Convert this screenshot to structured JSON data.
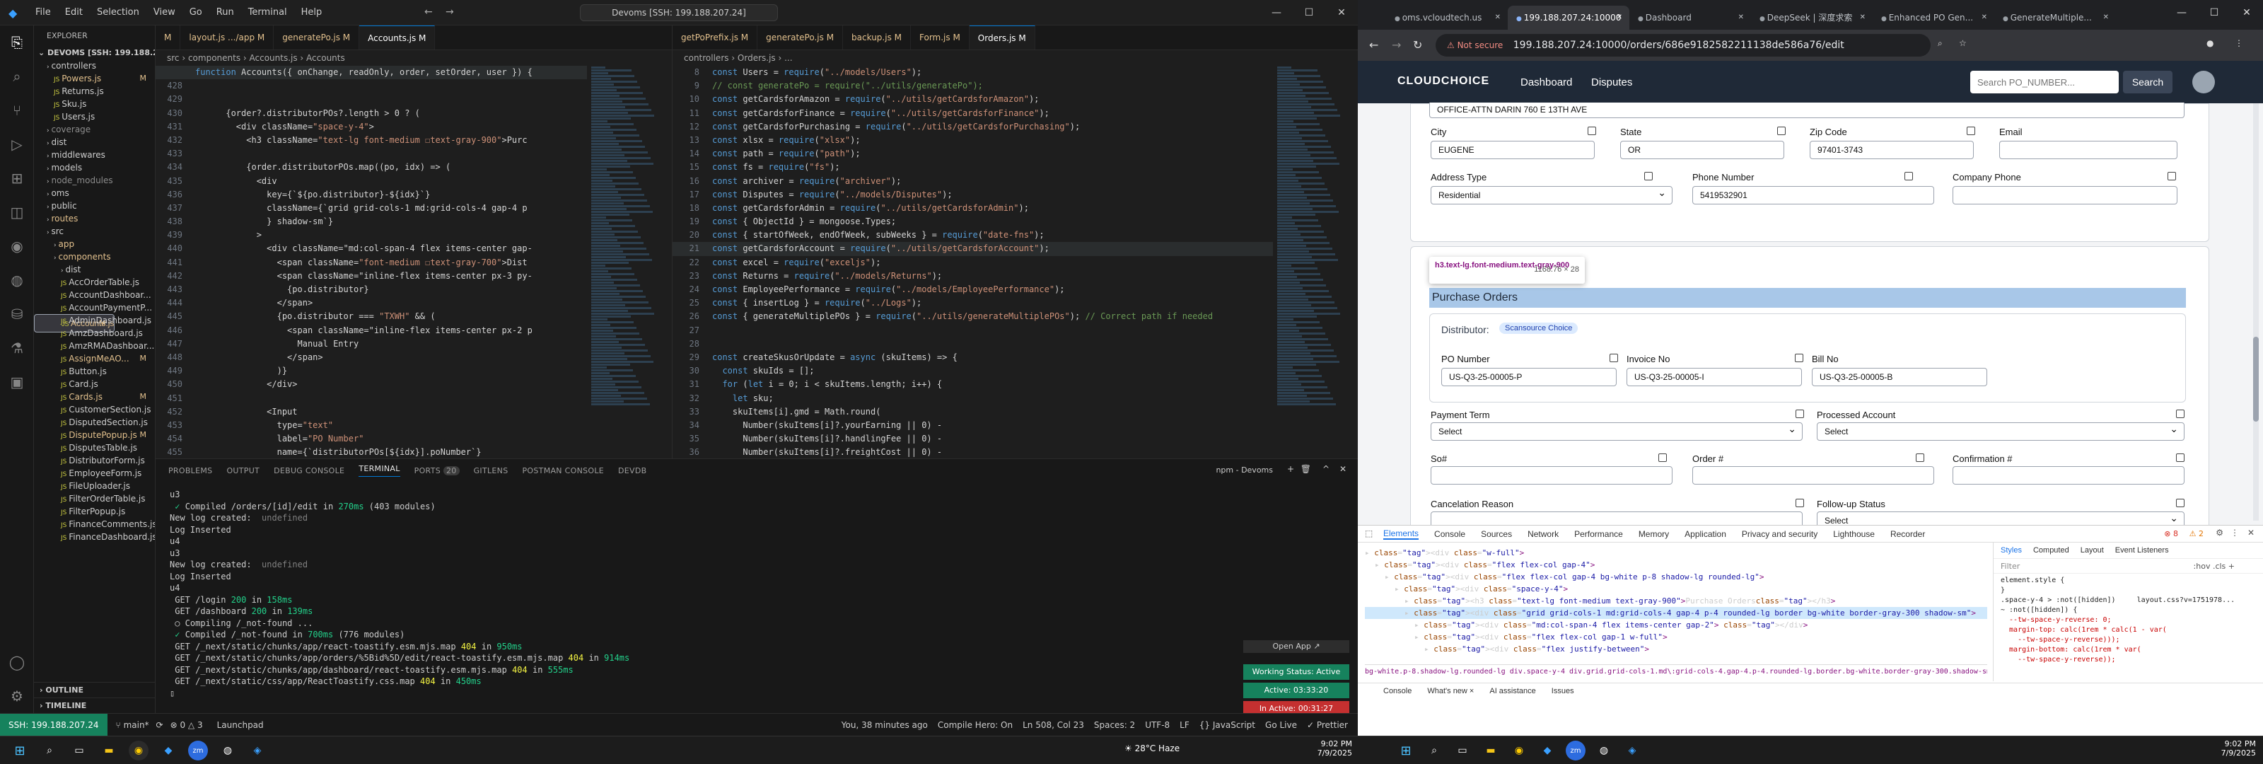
{
  "vscode": {
    "menu": [
      "File",
      "Edit",
      "Selection",
      "View",
      "Go",
      "Run",
      "Terminal",
      "Help"
    ],
    "search": "Devoms [SSH: 199.188.207.24]",
    "explorer_title": "EXPLORER",
    "root": "DEVOMS [SSH: 199.188.20...",
    "tree": [
      {
        "label": "controllers",
        "indent": 1,
        "badge": "",
        "color": "#cccccc"
      },
      {
        "label": "Powers.js",
        "indent": 2,
        "badge": "M",
        "color": "#e2c08d"
      },
      {
        "label": "Returns.js",
        "indent": 2,
        "badge": "",
        "color": "#cccccc"
      },
      {
        "label": "Sku.js",
        "indent": 2,
        "badge": "",
        "color": "#cccccc"
      },
      {
        "label": "Users.js",
        "indent": 2,
        "badge": "",
        "color": "#cccccc"
      },
      {
        "label": "coverage",
        "indent": 1,
        "badge": "",
        "color": "#8b8b8b"
      },
      {
        "label": "dist",
        "indent": 1,
        "badge": "",
        "color": "#cccccc"
      },
      {
        "label": "middlewares",
        "indent": 1,
        "badge": "",
        "color": "#cccccc"
      },
      {
        "label": "models",
        "indent": 1,
        "badge": "",
        "color": "#cccccc"
      },
      {
        "label": "node_modules",
        "indent": 1,
        "badge": "",
        "color": "#8b8b8b"
      },
      {
        "label": "oms",
        "indent": 1,
        "badge": "",
        "color": "#cccccc"
      },
      {
        "label": "public",
        "indent": 1,
        "badge": "",
        "color": "#cccccc"
      },
      {
        "label": "routes",
        "indent": 1,
        "badge": "",
        "color": "#e2c08d"
      },
      {
        "label": "src",
        "indent": 1,
        "badge": "",
        "color": "#cccccc"
      },
      {
        "label": "app",
        "indent": 2,
        "badge": "",
        "color": "#e2c08d"
      },
      {
        "label": "components",
        "indent": 2,
        "badge": "",
        "color": "#e2c08d"
      },
      {
        "label": "dist",
        "indent": 3,
        "badge": "",
        "color": "#cccccc"
      },
      {
        "label": "AccOrderTable.js",
        "indent": 3,
        "badge": "",
        "color": "#cccccc"
      },
      {
        "label": "AccountDashboar...",
        "indent": 3,
        "badge": "",
        "color": "#cccccc"
      },
      {
        "label": "AccountPaymentP...",
        "indent": 3,
        "badge": "",
        "color": "#cccccc"
      },
      {
        "label": "Accounts.js",
        "indent": 3,
        "badge": "M",
        "color": "#e2c08d",
        "sel": true
      },
      {
        "label": "AdminDashboard.js",
        "indent": 3,
        "badge": "",
        "color": "#cccccc"
      },
      {
        "label": "AmzDashboard.js",
        "indent": 3,
        "badge": "",
        "color": "#cccccc"
      },
      {
        "label": "AmzRMADashboar...",
        "indent": 3,
        "badge": "",
        "color": "#cccccc"
      },
      {
        "label": "AssignMeAO...",
        "indent": 3,
        "badge": "M",
        "color": "#e2c08d"
      },
      {
        "label": "Button.js",
        "indent": 3,
        "badge": "",
        "color": "#cccccc"
      },
      {
        "label": "Card.js",
        "indent": 3,
        "badge": "",
        "color": "#cccccc"
      },
      {
        "label": "Cards.js",
        "indent": 3,
        "badge": "M",
        "color": "#e2c08d"
      },
      {
        "label": "CustomerSection.js",
        "indent": 3,
        "badge": "",
        "color": "#cccccc"
      },
      {
        "label": "DisputedSection.js",
        "indent": 3,
        "badge": "",
        "color": "#cccccc"
      },
      {
        "label": "DisputePopup.js",
        "indent": 3,
        "badge": "M",
        "color": "#e2c08d"
      },
      {
        "label": "DisputesTable.js",
        "indent": 3,
        "badge": "",
        "color": "#cccccc"
      },
      {
        "label": "DistributorForm.js",
        "indent": 3,
        "badge": "",
        "color": "#cccccc"
      },
      {
        "label": "EmployeeForm.js",
        "indent": 3,
        "badge": "",
        "color": "#cccccc"
      },
      {
        "label": "FileUploader.js",
        "indent": 3,
        "badge": "",
        "color": "#cccccc"
      },
      {
        "label": "FilterOrderTable.js",
        "indent": 3,
        "badge": "",
        "color": "#cccccc"
      },
      {
        "label": "FilterPopup.js",
        "indent": 3,
        "badge": "",
        "color": "#cccccc"
      },
      {
        "label": "FinanceComments.js",
        "indent": 3,
        "badge": "",
        "color": "#cccccc"
      },
      {
        "label": "FinanceDashboard.js",
        "indent": 3,
        "badge": "",
        "color": "#cccccc"
      }
    ],
    "outline": "OUTLINE",
    "timeline": "TIMELINE",
    "tabs1": [
      {
        "label": "M",
        "active": false
      },
      {
        "label": "layout.js .../app M",
        "active": false
      },
      {
        "label": "generatePo.js M",
        "active": false
      },
      {
        "label": "Accounts.js M",
        "active": true
      }
    ],
    "bread1": "src › components › Accounts.js › Accounts",
    "code1": [
      {
        "n": "",
        "t": "function Accounts({ onChange, readOnly, order, setOrder, user }) {"
      },
      {
        "n": "428",
        "t": ""
      },
      {
        "n": "429",
        "t": ""
      },
      {
        "n": "430",
        "t": "      {order?.distributorPOs?.length > 0 ? ("
      },
      {
        "n": "431",
        "t": "        <div className=\"space-y-4\">"
      },
      {
        "n": "432",
        "t": "          <h3 className=\"text-lg font-medium ☐text-gray-900\">Purc"
      },
      {
        "n": "433",
        "t": ""
      },
      {
        "n": "434",
        "t": "          {order.distributorPOs.map((po, idx) => ("
      },
      {
        "n": "435",
        "t": "            <div"
      },
      {
        "n": "436",
        "t": "              key={`${po.distributor}-${idx}`}"
      },
      {
        "n": "437",
        "t": "              className={`grid grid-cols-1 md:grid-cols-4 gap-4 p"
      },
      {
        "n": "438",
        "t": "              } shadow-sm`}"
      },
      {
        "n": "439",
        "t": "            >"
      },
      {
        "n": "440",
        "t": "              <div className=\"md:col-span-4 flex items-center gap-"
      },
      {
        "n": "441",
        "t": "                <span className=\"font-medium ☐text-gray-700\">Dist"
      },
      {
        "n": "442",
        "t": "                <span className=\"inline-flex items-center px-3 py-"
      },
      {
        "n": "443",
        "t": "                  {po.distributor}"
      },
      {
        "n": "444",
        "t": "                </span>"
      },
      {
        "n": "445",
        "t": "                {po.distributor === \"TXWH\" && ("
      },
      {
        "n": "446",
        "t": "                  <span className=\"inline-flex items-center px-2 p"
      },
      {
        "n": "447",
        "t": "                    Manual Entry"
      },
      {
        "n": "448",
        "t": "                  </span>"
      },
      {
        "n": "449",
        "t": "                )}"
      },
      {
        "n": "450",
        "t": "              </div>"
      },
      {
        "n": "451",
        "t": ""
      },
      {
        "n": "452",
        "t": "              <Input"
      },
      {
        "n": "453",
        "t": "                type=\"text\""
      },
      {
        "n": "454",
        "t": "                label=\"PO Number\""
      },
      {
        "n": "455",
        "t": "                name={`distributorPOs[${idx}].poNumber`}"
      }
    ],
    "tabs2": [
      {
        "label": "getPoPrefix.js M",
        "active": false
      },
      {
        "label": "generatePo.js M",
        "active": false
      },
      {
        "label": "backup.js M",
        "active": false
      },
      {
        "label": "Form.js M",
        "active": false
      },
      {
        "label": "Orders.js M",
        "active": true
      }
    ],
    "bread2": "controllers › Orders.js › ...",
    "code2": [
      {
        "n": "8",
        "t": "const Users = require(\"../models/Users\");"
      },
      {
        "n": "9",
        "t": "// const generatePo = require(\"../utils/generatePo\");"
      },
      {
        "n": "10",
        "t": "const getCardsforAmazon = require(\"../utils/getCardsforAmazon\");"
      },
      {
        "n": "11",
        "t": "const getCardsforFinance = require(\"../utils/getCardsforFinance\");"
      },
      {
        "n": "12",
        "t": "const getCardsforPurchasing = require(\"../utils/getCardsforPurchasing\");"
      },
      {
        "n": "13",
        "t": "const xlsx = require(\"xlsx\");"
      },
      {
        "n": "14",
        "t": "const path = require(\"path\");"
      },
      {
        "n": "15",
        "t": "const fs = require(\"fs\");"
      },
      {
        "n": "16",
        "t": "const archiver = require(\"archiver\");"
      },
      {
        "n": "17",
        "t": "const Disputes = require(\"../models/Disputes\");"
      },
      {
        "n": "18",
        "t": "const getCardsforAdmin = require(\"../utils/getCardsforAdmin\");"
      },
      {
        "n": "19",
        "t": "const { ObjectId } = mongoose.Types;"
      },
      {
        "n": "20",
        "t": "const { startOfWeek, endOfWeek, subWeeks } = require(\"date-fns\");"
      },
      {
        "n": "21",
        "t": "const getCardsforAccount = require(\"../utils/getCardsforAccount\");"
      },
      {
        "n": "22",
        "t": "const excel = require(\"exceljs\");"
      },
      {
        "n": "23",
        "t": "const Returns = require(\"../models/Returns\");"
      },
      {
        "n": "24",
        "t": "const EmployeePerformance = require(\"../models/EmployeePerformance\");"
      },
      {
        "n": "25",
        "t": "const { insertLog } = require(\"../Logs\");"
      },
      {
        "n": "26",
        "t": "const { generateMultiplePOs } = require(\"../utils/generateMultiplePOs\"); // Correct path if needed"
      },
      {
        "n": "27",
        "t": ""
      },
      {
        "n": "28",
        "t": ""
      },
      {
        "n": "29",
        "t": "const createSkusOrUpdate = async (skuItems) => {"
      },
      {
        "n": "30",
        "t": "  const skuIds = [];"
      },
      {
        "n": "31",
        "t": "  for (let i = 0; i < skuItems.length; i++) {"
      },
      {
        "n": "32",
        "t": "    let sku;"
      },
      {
        "n": "33",
        "t": "    skuItems[i].gmd = Math.round("
      },
      {
        "n": "34",
        "t": "      Number(skuItems[i]?.yourEarning || 0) -"
      },
      {
        "n": "35",
        "t": "      Number(skuItems[i]?.handlingFee || 0) -"
      },
      {
        "n": "36",
        "t": "      Number(skuItems[i]?.freightCost || 0) -"
      }
    ],
    "panel_tabs": [
      "PROBLEMS",
      "OUTPUT",
      "DEBUG CONSOLE",
      "TERMINAL",
      "PORTS",
      "GITLENS",
      "POSTMAN CONSOLE",
      "DEVDB"
    ],
    "ports_count": "20",
    "terminal_name": "npm - Devoms",
    "terminal": [
      "u3",
      " ✓ Compiled /orders/[id]/edit in 270ms (403 modules)",
      "New log created:  undefined",
      "Log Inserted",
      "u4",
      "u3",
      "New log created:  undefined",
      "Log Inserted",
      "u4",
      " GET /login 200 in 158ms",
      " GET /dashboard 200 in 139ms",
      " ○ Compiling /_not-found ...",
      " ✓ Compiled /_not-found in 700ms (776 modules)",
      " GET /_next/static/chunks/app/react-toastify.esm.mjs.map 404 in 950ms",
      " GET /_next/static/chunks/app/orders/%5Bid%5D/edit/react-toastify.esm.mjs.map 404 in 914ms",
      " GET /_next/static/chunks/app/dashboard/react-toastify.esm.mjs.map 404 in 555ms",
      " GET /_next/static/css/app/ReactToastify.css.map 404 in 450ms",
      "▯"
    ],
    "working_status": "Working Status: Active",
    "active_time": "Active: 03:33:20",
    "inactive_time": "In Active: 00:31:27",
    "open_app": "Open App ↗",
    "status": {
      "remote": "SSH: 199.188.207.24",
      "branch": "main*",
      "sync": "⟳",
      "errors": "⊗ 0 △ 3",
      "launch": "Launchpad",
      "blame": "You, 38 minutes ago",
      "compile": "Compile Hero: On",
      "pos": "Ln 508, Col 23",
      "spaces": "Spaces: 2",
      "enc": "UTF-8",
      "eol": "LF",
      "lang": "{} JavaScript",
      "golive": "Go Live",
      "prettier": "✓ Prettier"
    }
  },
  "chrome": {
    "tabs": [
      {
        "label": "oms.vcloudtech.us",
        "active": false
      },
      {
        "label": "199.188.207.24:10000",
        "active": true
      },
      {
        "label": "Dashboard",
        "active": false
      },
      {
        "label": "DeepSeek | 深度求索",
        "active": false
      },
      {
        "label": "Enhanced PO Gen...",
        "active": false
      },
      {
        "label": "GenerateMultiple...",
        "active": false
      }
    ],
    "not_secure": "Not secure",
    "url": "199.188.207.24:10000/orders/686e9182582211138de586a76/edit",
    "app": {
      "logo": "CLOUDCHOICE",
      "nav": [
        "Dashboard",
        "Disputes"
      ],
      "search_placeholder": "Search PO_NUMBER...",
      "search_btn": "Search"
    },
    "address_value": "OFFICE-ATTN DARIN 760 E 13TH AVE",
    "fields": {
      "city_label": "City",
      "city": "EUGENE",
      "state_label": "State",
      "state": "OR",
      "zip_label": "Zip Code",
      "zip": "97401-3743",
      "email_label": "Email",
      "email": "",
      "addr_type_label": "Address Type",
      "addr_type": "Residential",
      "phone_label": "Phone Number",
      "phone": "5419532901",
      "cphone_label": "Company Phone",
      "cphone": ""
    },
    "tooltip": {
      "selector": "h3.text-lg.font-medium.text-gray-900",
      "size": "1168.76 × 28"
    },
    "po": {
      "title": "Purchase Orders",
      "dist_label": "Distributor:",
      "dist_value": "Scansource Choice",
      "po_label": "PO Number",
      "po_value": "US-Q3-25-00005-P",
      "inv_label": "Invoice No",
      "inv_value": "US-Q3-25-00005-I",
      "bill_label": "Bill No",
      "bill_value": "US-Q3-25-00005-B",
      "payterm_label": "Payment Term",
      "payterm": "Select",
      "processed_label": "Processed Account",
      "processed": "Select",
      "so_label": "So#",
      "order_label": "Order #",
      "confirm_label": "Confirmation #",
      "cancel_label": "Cancelation Reason",
      "followup_label": "Follow-up Status",
      "followup": "Select"
    },
    "devtools": {
      "tabs": [
        "Elements",
        "Console",
        "Sources",
        "Network",
        "Performance",
        "Memory",
        "Application",
        "Privacy and security",
        "Lighthouse",
        "Recorder"
      ],
      "errors": "⊗ 8",
      "warnings": "⚠ 2",
      "dom": [
        {
          "i": 0,
          "html": "<div class=\"w-full\">"
        },
        {
          "i": 1,
          "html": "<div class=\"flex flex-col gap-4\">"
        },
        {
          "i": 2,
          "html": "<div class=\"flex flex-col gap-4 bg-white p-8 shadow-lg rounded-lg\">"
        },
        {
          "i": 3,
          "html": "<div class=\"space-y-4\">"
        },
        {
          "i": 4,
          "html": "<h3 class=\"text-lg font-medium text-gray-900\">Purchase Orders</h3>"
        },
        {
          "i": 4,
          "html": "<div class=\"grid grid-cols-1 md:grid-cols-4 gap-4 p-4 rounded-lg border bg-white border-gray-300 shadow-sm\">",
          "sel": true
        },
        {
          "i": 5,
          "html": "<div class=\"md:col-span-4 flex items-center gap-2\"> </div>"
        },
        {
          "i": 5,
          "html": "<div class=\"flex flex-col gap-1 w-full\">"
        },
        {
          "i": 6,
          "html": "<div class=\"flex justify-between\">"
        }
      ],
      "crumbs": "bg-white.p-8.shadow-lg.rounded-lg   div.space-y-4   div.grid.grid-cols-1.md\\:grid-cols-4.gap-4.p-4.rounded-lg.border.bg-white.border-gray-300.shadow-sm",
      "style_tabs": [
        "Styles",
        "Computed",
        "Layout",
        "Event Listeners"
      ],
      "filter": "Filter",
      "hov": ":hov .cls +",
      "styles": [
        "element.style {",
        "}",
        ".space-y-4 > :not([hidden])     layout.css?v=1751978...",
        "~ :not([hidden]) {",
        "  --tw-space-y-reverse: 0;",
        "  margin-top: calc(1rem * calc(1 - var(",
        "    --tw-space-y-reverse)));",
        "  margin-bottom: calc(1rem * var(",
        "    --tw-space-y-reverse));"
      ],
      "drawer": [
        "Console",
        "What's new ×",
        "AI assistance",
        "Issues"
      ]
    }
  },
  "taskbar": {
    "weather": "28°C Haze",
    "time": "9:02 PM",
    "date": "7/9/2025",
    "tray_time": "9:02 PM",
    "tray_date": "7/9/2025"
  }
}
